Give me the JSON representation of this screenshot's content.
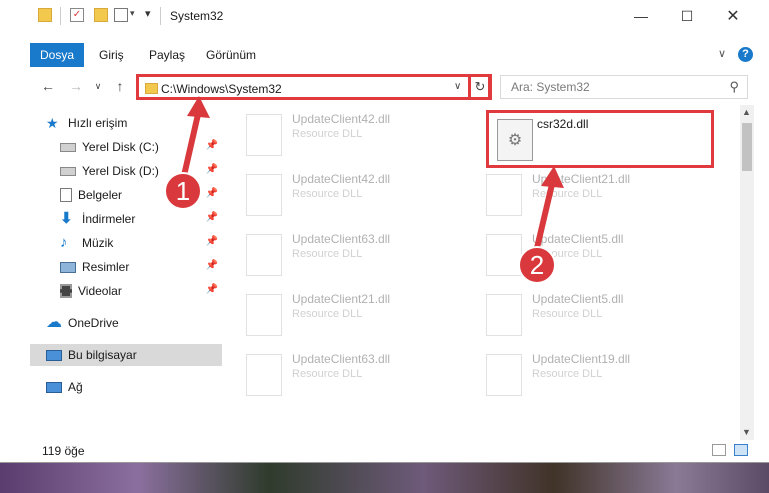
{
  "window": {
    "title": "System32"
  },
  "ribbon": {
    "tabs": [
      "Dosya",
      "Giriş",
      "Paylaş",
      "Görünüm"
    ]
  },
  "address": {
    "path": "C:\\Windows\\System32"
  },
  "search": {
    "placeholder": "Ara: System32"
  },
  "sidebar": {
    "quick_access": "Hızlı erişim",
    "items": [
      {
        "label": "Yerel Disk (C:)",
        "icon": "drive-icon"
      },
      {
        "label": "Yerel Disk (D:)",
        "icon": "drive-icon"
      },
      {
        "label": "Belgeler",
        "icon": "documents-icon"
      },
      {
        "label": "İndirmeler",
        "icon": "download-icon"
      },
      {
        "label": "Müzik",
        "icon": "music-icon"
      },
      {
        "label": "Resimler",
        "icon": "pictures-icon"
      },
      {
        "label": "Videolar",
        "icon": "videos-icon"
      }
    ],
    "onedrive": "OneDrive",
    "this_pc": "Bu bilgisayar",
    "network": "Ağ"
  },
  "files": [
    {
      "name": "UpdateClient42.dll",
      "desc": "Resource DLL"
    },
    {
      "name": "csr32d.dll",
      "desc": ""
    },
    {
      "name": "UpdateClient42.dll",
      "desc": "Resource DLL"
    },
    {
      "name": "UpdateClient21.dll",
      "desc": "Resource DLL"
    },
    {
      "name": "UpdateClient63.dll",
      "desc": "Resource DLL"
    },
    {
      "name": "UpdateClient5.dll",
      "desc": "Resource DLL"
    },
    {
      "name": "UpdateClient21.dll",
      "desc": "Resource DLL"
    },
    {
      "name": "UpdateClient5.dll",
      "desc": "Resource DLL"
    },
    {
      "name": "UpdateClient63.dll",
      "desc": "Resource DLL"
    },
    {
      "name": "UpdateClient19.dll",
      "desc": "Resource DLL"
    }
  ],
  "status": {
    "count": "119 öğe"
  },
  "annotations": {
    "step1": "1",
    "step2": "2"
  },
  "colors": {
    "accent": "#1979ca",
    "highlight": "#e0393e"
  }
}
